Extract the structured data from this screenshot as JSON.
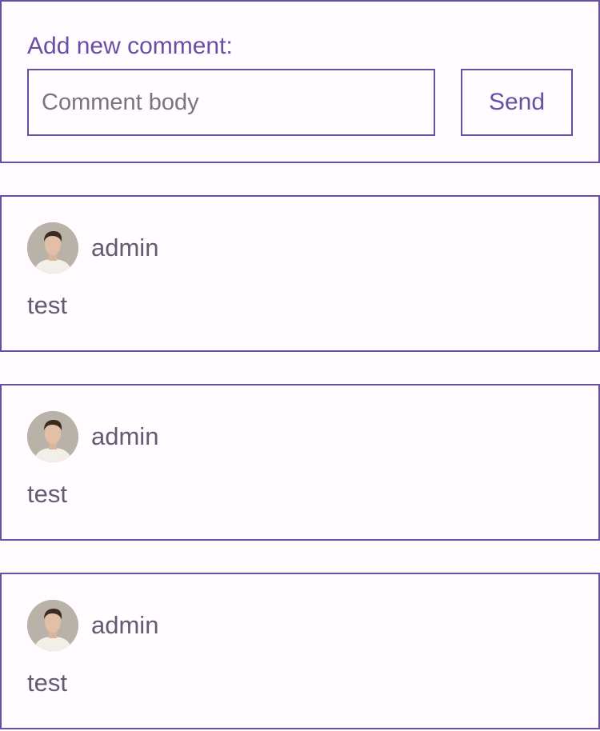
{
  "new_comment": {
    "label": "Add new comment:",
    "input_value": "",
    "input_placeholder": "Comment body",
    "send_label": "Send"
  },
  "comments": [
    {
      "author": "admin",
      "avatar_icon": "user-photo-icon",
      "body": "test"
    },
    {
      "author": "admin",
      "avatar_icon": "user-photo-icon",
      "body": "test"
    },
    {
      "author": "admin",
      "avatar_icon": "user-photo-icon",
      "body": "test"
    }
  ],
  "colors": {
    "accent": "#6750a4",
    "text": "#625b71",
    "background": "#fffbfe",
    "placeholder": "#79747e"
  }
}
